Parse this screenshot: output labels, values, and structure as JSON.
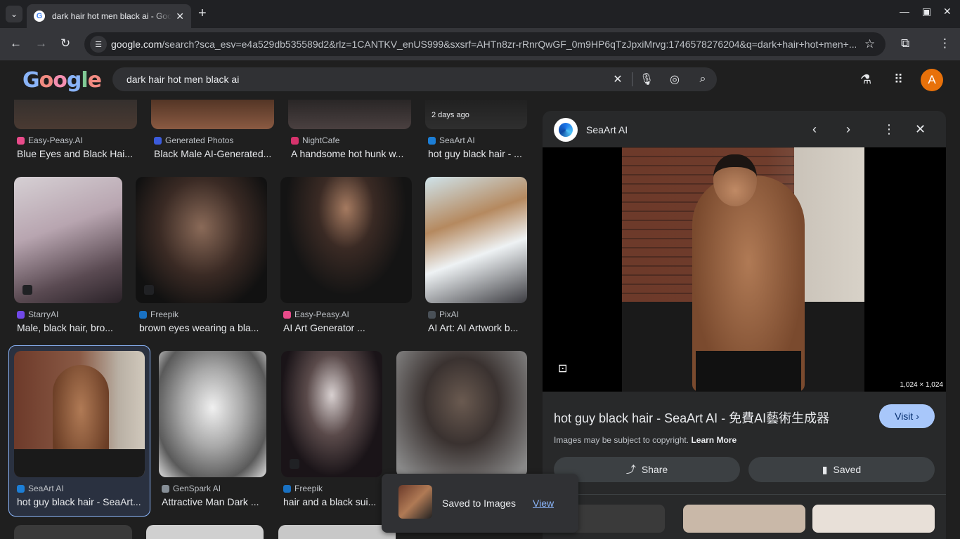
{
  "browser": {
    "tab_title": "dark hair hot men black ai - Google Search",
    "tab_favicon": "G",
    "url_host": "google.com",
    "url_rest": "/search?sca_esv=e4a529db535589d2&rlz=1CANTKV_enUS999&sxsrf=AHTn8zr-rRnrQwGF_0m9HP6qTzJpxiMrvg:1746578276204&q=dark+hair+hot+men+..."
  },
  "search": {
    "query": "dark hair hot men black ai",
    "logo": "Google"
  },
  "account": {
    "initial": "A"
  },
  "results": {
    "row1": [
      {
        "source": "Easy-Peasy.AI",
        "caption": "Blue Eyes and Black Hai...",
        "fav_color": "#e94b8a"
      },
      {
        "source": "Generated Photos",
        "caption": "Black Male AI-Generated...",
        "fav_color": "#3b5bdb"
      },
      {
        "source": "NightCafe",
        "caption": "A handsome hot hunk w...",
        "fav_color": "#d6336c"
      },
      {
        "source": "SeaArt AI",
        "caption": "hot guy black hair - ...",
        "fav_color": "#1c7ed6",
        "badge": "2 days ago"
      }
    ],
    "row2": [
      {
        "source": "StarryAI",
        "caption": "Male, black hair, bro...",
        "fav_color": "#7048e8"
      },
      {
        "source": "Freepik",
        "caption": "brown eyes wearing a bla...",
        "fav_color": "#1971c2"
      },
      {
        "source": "Easy-Peasy.AI",
        "caption": "AI Art Generator ...",
        "fav_color": "#e94b8a"
      },
      {
        "source": "PixAI",
        "caption": "AI Art: AI Artwork b...",
        "fav_color": "#495057"
      }
    ],
    "row3": [
      {
        "source": "SeaArt AI",
        "caption": "hot guy black hair - SeaArt...",
        "fav_color": "#1c7ed6"
      },
      {
        "source": "GenSpark AI",
        "caption": "Attractive Man Dark ...",
        "fav_color": "#868e96"
      },
      {
        "source": "Freepik",
        "caption": "hair and a black sui...",
        "fav_color": "#1971c2"
      }
    ]
  },
  "panel": {
    "source_name": "SeaArt AI",
    "dimensions": "1,024 × 1,024",
    "title": "hot guy black hair - SeaArt AI - 免費AI藝術生成器",
    "visit_label": "Visit",
    "copyright_text": "Images may be subject to copyright.",
    "learn_more": "Learn More",
    "share_label": "Share",
    "saved_label": "Saved"
  },
  "toast": {
    "message": "Saved to Images",
    "action": "View"
  }
}
